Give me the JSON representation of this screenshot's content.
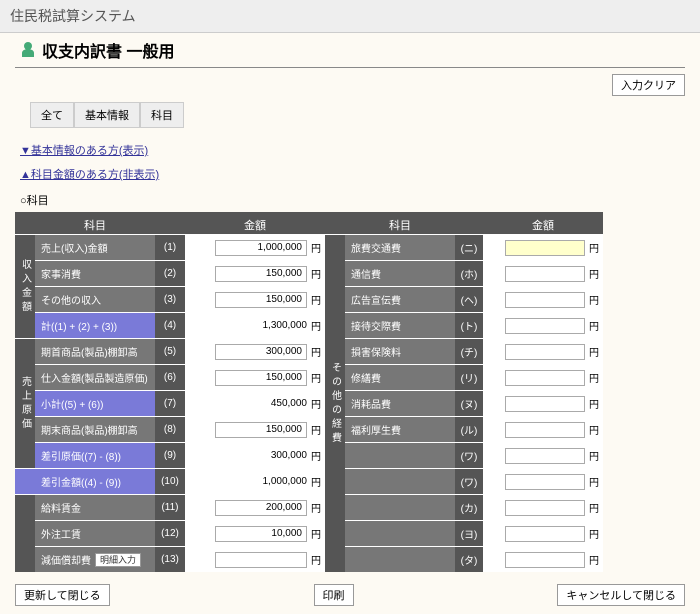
{
  "window_title": "住民税試算システム",
  "page_title": "収支内訳書 一般用",
  "buttons": {
    "clear": "入力クリア",
    "print": "印刷",
    "save_close": "更新して閉じる",
    "cancel_close": "キャンセルして閉じる",
    "detail": "明細入力"
  },
  "tabs": [
    "全て",
    "基本情報",
    "科目"
  ],
  "links": {
    "basic": "▼基本情報のある方(表示)",
    "items": "▲科目金額のある方(非表示)"
  },
  "section": "○科目",
  "hdr": {
    "item": "科目",
    "amount": "金額"
  },
  "unit": "円",
  "vlabel_left_top": "収入金額",
  "vlabel_left_bot": "売上原価",
  "vlabel_right": "その他の経費",
  "left": [
    {
      "label": "売上(収入)金額",
      "num": "(1)",
      "val": "1,000,000",
      "input": true
    },
    {
      "label": "家事消費",
      "num": "(2)",
      "val": "150,000",
      "input": true
    },
    {
      "label": "その他の収入",
      "num": "(3)",
      "val": "150,000",
      "input": true
    },
    {
      "label": "計((1) + (2) + (3))",
      "num": "(4)",
      "val": "1,300,000",
      "blue": true
    },
    {
      "label": "期首商品(製品)棚卸高",
      "num": "(5)",
      "val": "300,000",
      "input": true
    },
    {
      "label": "仕入金額(製品製造原価)",
      "num": "(6)",
      "val": "150,000",
      "input": true
    },
    {
      "label": "小計((5) + (6))",
      "num": "(7)",
      "val": "450,000",
      "blue": true
    },
    {
      "label": "期末商品(製品)棚卸高",
      "num": "(8)",
      "val": "150,000",
      "input": true
    },
    {
      "label": "差引原価((7) - (8))",
      "num": "(9)",
      "val": "300,000",
      "blue": true
    },
    {
      "label": "差引金額((4) - (9))",
      "num": "(10)",
      "val": "1,000,000",
      "blue": true,
      "full": true
    },
    {
      "label": "給料賃金",
      "num": "(11)",
      "val": "200,000",
      "input": true
    },
    {
      "label": "外注工賃",
      "num": "(12)",
      "val": "10,000",
      "input": true
    },
    {
      "label": "減価償却費",
      "num": "(13)",
      "val": "",
      "input": true,
      "btn": true
    }
  ],
  "right": [
    {
      "label": "旅費交通費",
      "num": "(ニ)",
      "hl": true
    },
    {
      "label": "通信費",
      "num": "(ホ)"
    },
    {
      "label": "広告宣伝費",
      "num": "(ヘ)"
    },
    {
      "label": "接待交際費",
      "num": "(ト)"
    },
    {
      "label": "損害保険料",
      "num": "(チ)"
    },
    {
      "label": "修繕費",
      "num": "(リ)"
    },
    {
      "label": "消耗品費",
      "num": "(ヌ)"
    },
    {
      "label": "福利厚生費",
      "num": "(ル)"
    },
    {
      "label": "",
      "num": "(ワ)"
    },
    {
      "label": "",
      "num": "(ワ)"
    },
    {
      "label": "",
      "num": "(カ)"
    },
    {
      "label": "",
      "num": "(ヨ)"
    },
    {
      "label": "",
      "num": "(タ)"
    }
  ]
}
